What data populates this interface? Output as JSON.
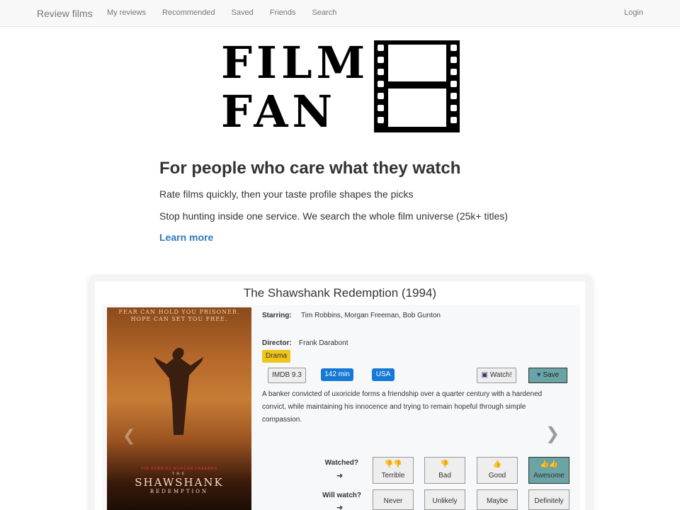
{
  "nav": {
    "brand": "Review films",
    "links": [
      "My reviews",
      "Recommended",
      "Saved",
      "Friends",
      "Search"
    ],
    "login": "Login"
  },
  "logo": {
    "line1": "FILM",
    "line2": "FAN"
  },
  "hero": {
    "title": "For people who care what they watch",
    "line1": "Rate films quickly, then your taste profile shapes the picks",
    "line2": "Stop hunting inside one service. We search the whole film universe (25k+ titles)",
    "learn_more": "Learn more"
  },
  "film": {
    "title": "The Shawshank Redemption (1994)",
    "starring_label": "Starring:",
    "starring": "Tim Robbins, Morgan Freeman, Bob Gunton",
    "director_label": "Director:",
    "director": "Frank Darabont",
    "genre": "Drama",
    "imdb": "IMDB 9.3",
    "runtime": "142 min",
    "country": "USA",
    "watch_label": "Watch!",
    "save_label": "Save",
    "description": "A banker convicted of uxoricide forms a friendship over a quarter century with a hardened convict, while maintaining his innocence and trying to remain hopeful through simple compassion.",
    "poster": {
      "tagline1": "FEAR CAN HOLD YOU PRISONER.",
      "tagline2": "HOPE CAN SET YOU FREE.",
      "actors": "TIM ROBBINS     MORGAN FREEMAN",
      "the": "THE",
      "title": "SHAWSHANK",
      "subtitle": "REDEMPTION"
    }
  },
  "rating": {
    "watched_label": "Watched?",
    "watched_options": [
      "Terrible",
      "Bad",
      "Good",
      "Awesome"
    ],
    "will_watch_label": "Will watch?",
    "will_watch_options": [
      "Never",
      "Unlikely",
      "Maybe",
      "Definitely"
    ],
    "arrow": "➜"
  },
  "colors": {
    "accent": "#337ab7",
    "chip_blue": "#1679d5",
    "drama": "#f0c419",
    "save_active": "#6aa4a4"
  }
}
